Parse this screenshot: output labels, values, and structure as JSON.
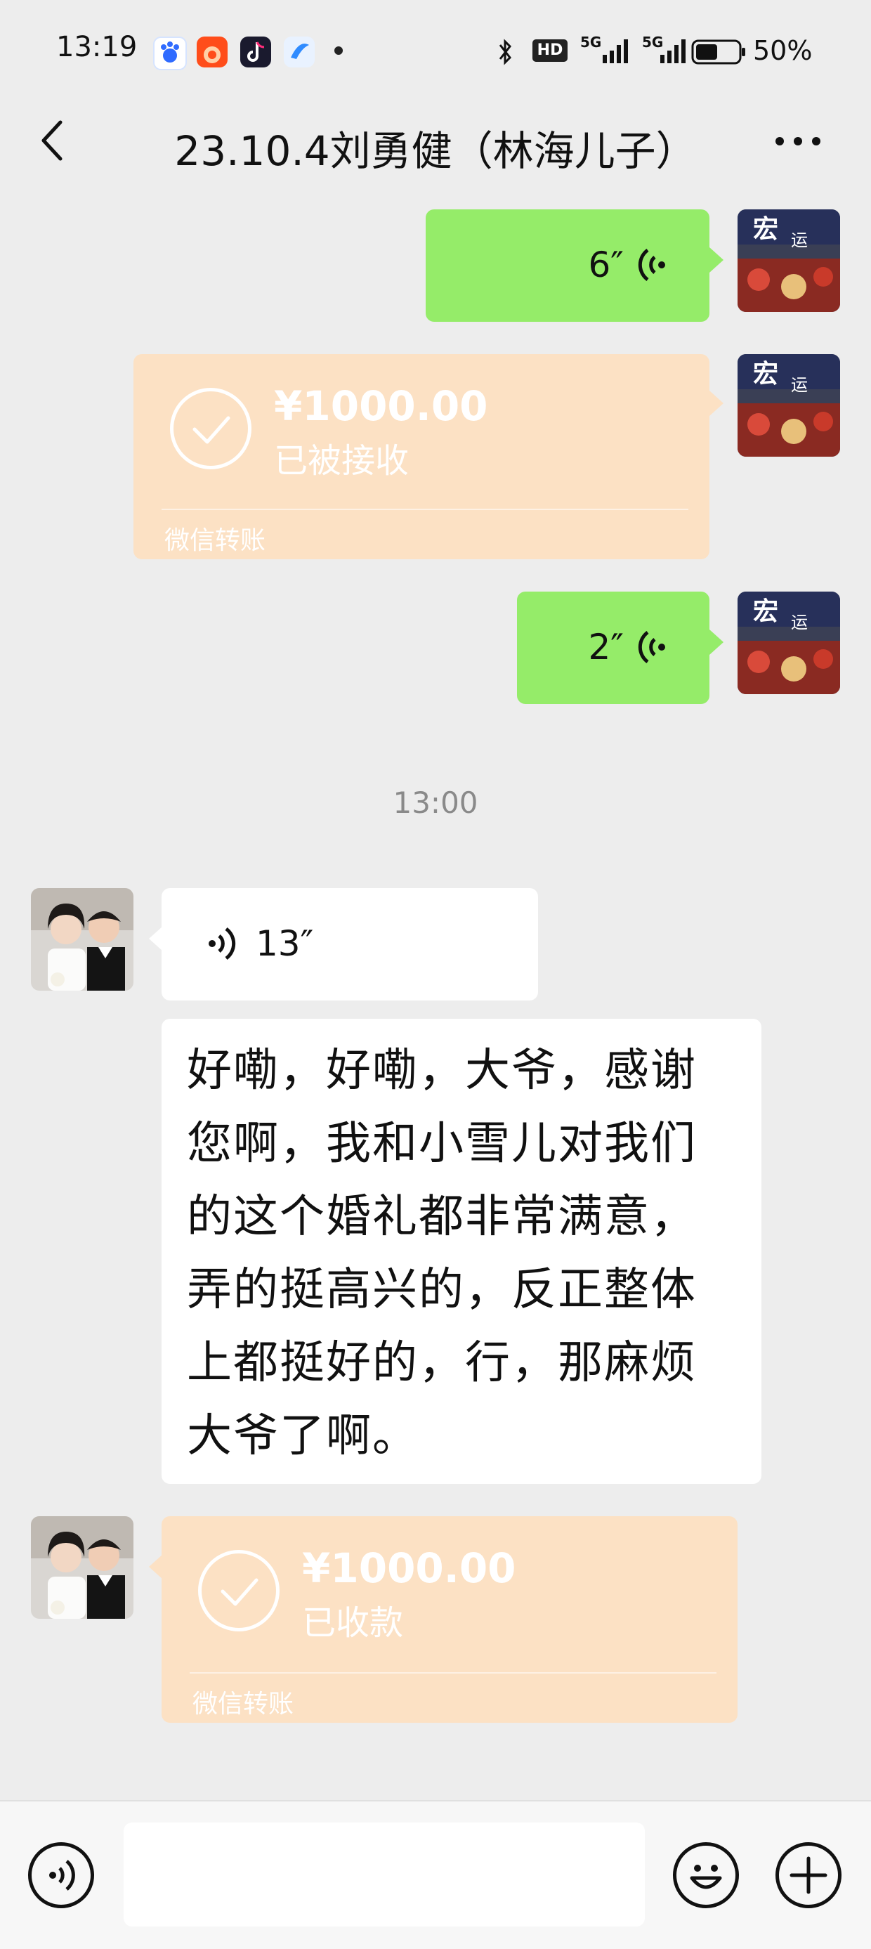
{
  "status_bar": {
    "time": "13:19",
    "apps": [
      "baidu-icon",
      "taobao-icon",
      "tiktok-icon",
      "browser-icon"
    ],
    "network_5g_a": "5G",
    "network_5g_b": "5G",
    "hd_badge": "HD",
    "battery": "50%"
  },
  "header": {
    "back_icon": "chevron-left-icon",
    "title": "23.10.4刘勇健（林海儿子）",
    "more_icon": "more-dots-icon"
  },
  "messages": {
    "m1_voice": {
      "duration": "6″"
    },
    "m2_transfer": {
      "amount": "¥1000.00",
      "status": "已被接收",
      "label": "微信转账"
    },
    "m3_voice": {
      "duration": "2″"
    },
    "timestamp": "13:00",
    "m4_voice": {
      "duration": "13″"
    },
    "m5_text": {
      "lines": [
        "好嘞，好嘞，大爷，感谢",
        "您啊，我和小雪儿对我们",
        "的这个婚礼都非常满意，",
        "弄的挺高兴的，反正整体",
        "上都挺好的，行，那麻烦",
        "大爷了啊。"
      ]
    },
    "m6_transfer": {
      "amount": "¥1000.00",
      "status": "已收款",
      "label": "微信转账"
    }
  },
  "input_bar": {
    "voice_icon": "voice-mode-icon",
    "emoji_icon": "emoji-icon",
    "plus_icon": "plus-icon",
    "input_value": ""
  },
  "colors": {
    "background": "#ededed",
    "outgoing_bubble": "#95ec69",
    "incoming_bubble": "#ffffff",
    "transfer_bubble": "#fce1c4"
  }
}
